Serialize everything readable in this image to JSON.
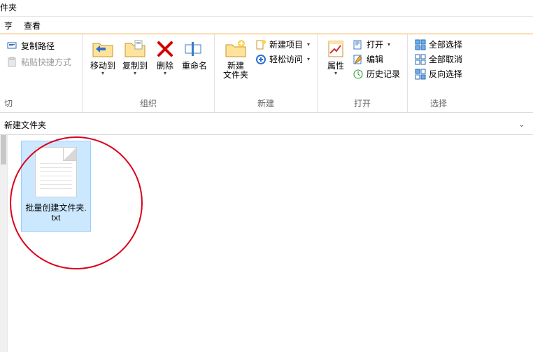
{
  "window": {
    "title_fragment": "件夹"
  },
  "menu": {
    "item1": "亨",
    "view": "查看"
  },
  "ribbon": {
    "clipboard": {
      "copy_path": "复制路径",
      "paste_shortcut": "粘贴快捷方式",
      "single_char": "切"
    },
    "organize": {
      "move_to": "移动到",
      "copy_to": "复制到",
      "delete": "删除",
      "rename": "重命名",
      "group_label": "组织"
    },
    "new": {
      "new_folder": "新建\n文件夹",
      "new_item": "新建项目",
      "easy_access": "轻松访问",
      "group_label": "新建"
    },
    "open": {
      "properties": "属性",
      "open_btn": "打开",
      "edit": "编辑",
      "history": "历史记录",
      "group_label": "打开"
    },
    "select": {
      "select_all": "全部选择",
      "select_none": "全部取消",
      "invert": "反向选择",
      "group_label": "选择"
    }
  },
  "address": {
    "path": "新建文件夹"
  },
  "files": {
    "item1": {
      "name": "批量创建文件夹.\ntxt"
    }
  }
}
